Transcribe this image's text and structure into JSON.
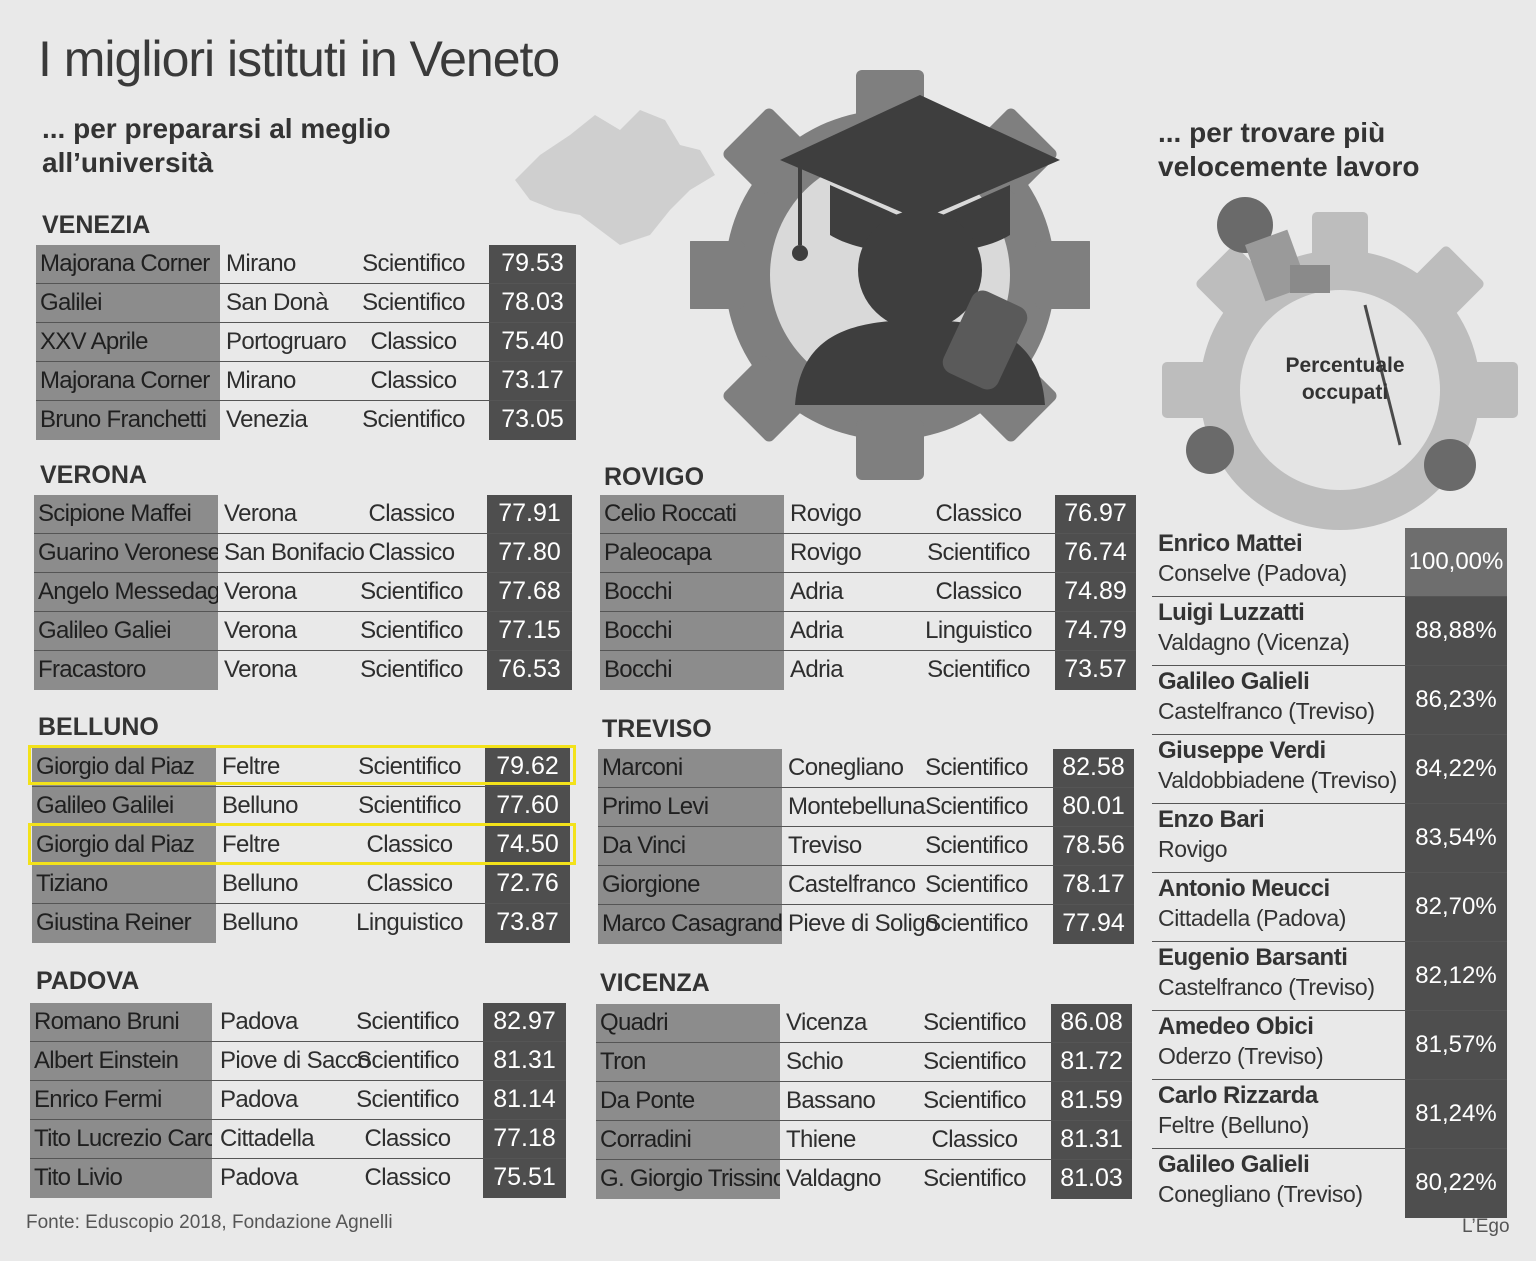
{
  "title": "I migliori istituti in Veneto",
  "subtitle_left": "... per prepararsi al meglio all’università",
  "subtitle_right": "... per trovare più velocemente lavoro",
  "illustration": {
    "icons": [
      "veneto-map-icon",
      "gear-icon",
      "graduate-icon",
      "people-working-icon"
    ],
    "center_label": "Percentuale occupati"
  },
  "provinces": {
    "venezia": {
      "name": "VENEZIA",
      "rows": [
        {
          "school": "Majorana Corner",
          "city": "Mirano",
          "type": "Scientifico",
          "score": "79.53"
        },
        {
          "school": "Galilei",
          "city": "San Donà",
          "type": "Scientifico",
          "score": "78.03"
        },
        {
          "school": "XXV Aprile",
          "city": "Portogruaro",
          "type": "Classico",
          "score": "75.40"
        },
        {
          "school": "Majorana Corner",
          "city": "Mirano",
          "type": "Classico",
          "score": "73.17"
        },
        {
          "school": "Bruno Franchetti",
          "city": "Venezia",
          "type": "Scientifico",
          "score": "73.05"
        }
      ]
    },
    "verona": {
      "name": "VERONA",
      "rows": [
        {
          "school": "Scipione Maffei",
          "city": "Verona",
          "type": "Classico",
          "score": "77.91"
        },
        {
          "school": "Guarino Veronese",
          "city": "San Bonifacio",
          "type": "Classico",
          "score": "77.80"
        },
        {
          "school": "Angelo Messedaglia",
          "city": "Verona",
          "type": "Scientifico",
          "score": "77.68"
        },
        {
          "school": "Galileo Galiei",
          "city": "Verona",
          "type": "Scientifico",
          "score": "77.15"
        },
        {
          "school": "Fracastoro",
          "city": "Verona",
          "type": "Scientifico",
          "score": "76.53"
        }
      ]
    },
    "belluno": {
      "name": "BELLUNO",
      "rows": [
        {
          "school": "Giorgio dal Piaz",
          "city": "Feltre",
          "type": "Scientifico",
          "score": "79.62"
        },
        {
          "school": "Galileo Galilei",
          "city": "Belluno",
          "type": "Scientifico",
          "score": "77.60"
        },
        {
          "school": "Giorgio dal Piaz",
          "city": "Feltre",
          "type": "Classico",
          "score": "74.50"
        },
        {
          "school": "Tiziano",
          "city": "Belluno",
          "type": "Classico",
          "score": "72.76"
        },
        {
          "school": "Giustina Reiner",
          "city": "Belluno",
          "type": "Linguistico",
          "score": "73.87"
        }
      ]
    },
    "padova": {
      "name": "PADOVA",
      "rows": [
        {
          "school": "Romano Bruni",
          "city": "Padova",
          "type": "Scientifico",
          "score": "82.97"
        },
        {
          "school": "Albert Einstein",
          "city": "Piove di Sacco",
          "type": "Scientifico",
          "score": "81.31"
        },
        {
          "school": "Enrico Fermi",
          "city": "Padova",
          "type": "Scientifico",
          "score": "81.14"
        },
        {
          "school": "Tito Lucrezio Caro",
          "city": "Cittadella",
          "type": "Classico",
          "score": "77.18"
        },
        {
          "school": "Tito Livio",
          "city": "Padova",
          "type": "Classico",
          "score": "75.51"
        }
      ]
    },
    "rovigo": {
      "name": "ROVIGO",
      "rows": [
        {
          "school": "Celio Roccati",
          "city": "Rovigo",
          "type": "Classico",
          "score": "76.97"
        },
        {
          "school": "Paleocapa",
          "city": "Rovigo",
          "type": "Scientifico",
          "score": "76.74"
        },
        {
          "school": "Bocchi",
          "city": "Adria",
          "type": "Classico",
          "score": "74.89"
        },
        {
          "school": "Bocchi",
          "city": "Adria",
          "type": "Linguistico",
          "score": "74.79"
        },
        {
          "school": "Bocchi",
          "city": "Adria",
          "type": "Scientifico",
          "score": "73.57"
        }
      ]
    },
    "treviso": {
      "name": "TREVISO",
      "rows": [
        {
          "school": "Marconi",
          "city": "Conegliano",
          "type": "Scientifico",
          "score": "82.58"
        },
        {
          "school": "Primo Levi",
          "city": "Montebelluna",
          "type": "Scientifico",
          "score": "80.01"
        },
        {
          "school": "Da Vinci",
          "city": "Treviso",
          "type": "Scientifico",
          "score": "78.56"
        },
        {
          "school": "Giorgione",
          "city": "Castelfranco",
          "type": "Scientifico",
          "score": "78.17"
        },
        {
          "school": "Marco Casagrande",
          "city": "Pieve di Soligo",
          "type": "Scientifico",
          "score": "77.94"
        }
      ]
    },
    "vicenza": {
      "name": "VICENZA",
      "rows": [
        {
          "school": "Quadri",
          "city": "Vicenza",
          "type": "Scientifico",
          "score": "86.08"
        },
        {
          "school": "Tron",
          "city": "Schio",
          "type": "Scientifico",
          "score": "81.72"
        },
        {
          "school": "Da Ponte",
          "city": "Bassano",
          "type": "Scientifico",
          "score": "81.59"
        },
        {
          "school": "Corradini",
          "city": "Thiene",
          "type": "Classico",
          "score": "81.31"
        },
        {
          "school": "G. Giorgio Trissino",
          "city": "Valdagno",
          "type": "Scientifico",
          "score": "81.03"
        }
      ]
    }
  },
  "employment": [
    {
      "name": "Enrico Mattei",
      "location": "Conselve (Padova)",
      "pct": "100,00%"
    },
    {
      "name": "Luigi Luzzatti",
      "location": "Valdagno (Vicenza)",
      "pct": "88,88%"
    },
    {
      "name": "Galileo Galieli",
      "location": "Castelfranco (Treviso)",
      "pct": "86,23%"
    },
    {
      "name": "Giuseppe Verdi",
      "location": "Valdobbiadene (Treviso)",
      "pct": "84,22%"
    },
    {
      "name": "Enzo Bari",
      "location": "Rovigo",
      "pct": "83,54%"
    },
    {
      "name": "Antonio Meucci",
      "location": "Cittadella (Padova)",
      "pct": "82,70%"
    },
    {
      "name": "Eugenio Barsanti",
      "location": "Castelfranco (Treviso)",
      "pct": "82,12%"
    },
    {
      "name": "Amedeo Obici",
      "location": "Oderzo (Treviso)",
      "pct": "81,57%"
    },
    {
      "name": "Carlo Rizzarda",
      "location": "Feltre (Belluno)",
      "pct": "81,24%"
    },
    {
      "name": "Galileo Galieli",
      "location": "Conegliano (Treviso)",
      "pct": "80,22%"
    }
  ],
  "highlight_color": "#f3e21a",
  "source": "Fonte: Eduscopio 2018, Fondazione Agnelli",
  "credit": "L’Ego"
}
